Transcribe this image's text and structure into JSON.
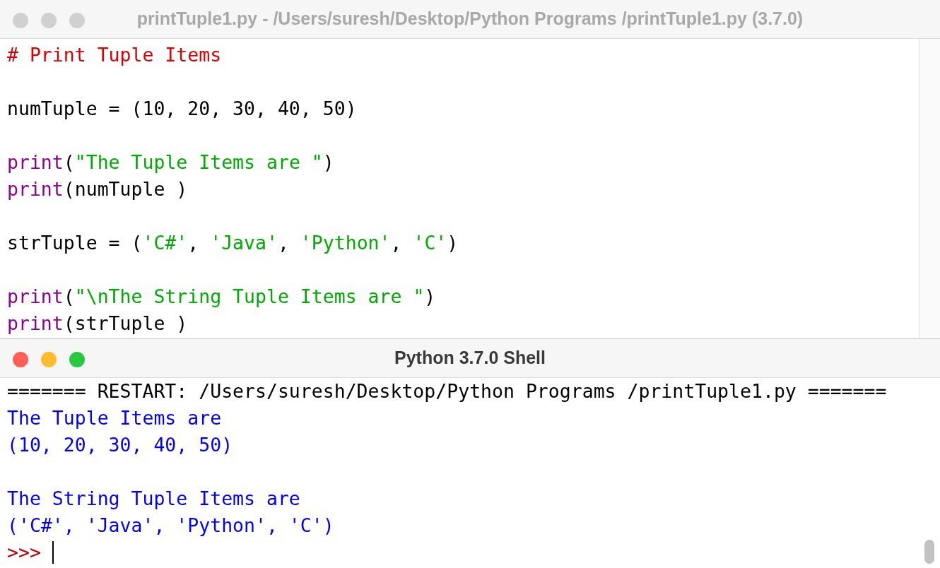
{
  "editor": {
    "title": "printTuple1.py - /Users/suresh/Desktop/Python Programs /printTuple1.py (3.7.0)",
    "active": false,
    "lines": [
      {
        "kind": "code",
        "tokens": [
          {
            "text": "# Print Tuple Items",
            "kind": "comment"
          }
        ]
      },
      {
        "kind": "blank"
      },
      {
        "kind": "code",
        "tokens": [
          {
            "text": "numTuple = (10, 20, 30, 40, 50)",
            "kind": "plain"
          }
        ]
      },
      {
        "kind": "blank"
      },
      {
        "kind": "code",
        "tokens": [
          {
            "text": "print",
            "kind": "builtin"
          },
          {
            "text": "(",
            "kind": "plain"
          },
          {
            "text": "\"The Tuple Items are \"",
            "kind": "string"
          },
          {
            "text": ")",
            "kind": "plain"
          }
        ]
      },
      {
        "kind": "code",
        "tokens": [
          {
            "text": "print",
            "kind": "builtin"
          },
          {
            "text": "(numTuple )",
            "kind": "plain"
          }
        ]
      },
      {
        "kind": "blank"
      },
      {
        "kind": "code",
        "tokens": [
          {
            "text": "strTuple = (",
            "kind": "plain"
          },
          {
            "text": "'C#'",
            "kind": "string"
          },
          {
            "text": ", ",
            "kind": "plain"
          },
          {
            "text": "'Java'",
            "kind": "string"
          },
          {
            "text": ", ",
            "kind": "plain"
          },
          {
            "text": "'Python'",
            "kind": "string"
          },
          {
            "text": ", ",
            "kind": "plain"
          },
          {
            "text": "'C'",
            "kind": "string"
          },
          {
            "text": ")",
            "kind": "plain"
          }
        ]
      },
      {
        "kind": "blank"
      },
      {
        "kind": "code",
        "tokens": [
          {
            "text": "print",
            "kind": "builtin"
          },
          {
            "text": "(",
            "kind": "plain"
          },
          {
            "text": "\"\\nThe String Tuple Items are \"",
            "kind": "string"
          },
          {
            "text": ")",
            "kind": "plain"
          }
        ]
      },
      {
        "kind": "code",
        "tokens": [
          {
            "text": "print",
            "kind": "builtin"
          },
          {
            "text": "(strTuple )",
            "kind": "plain"
          }
        ]
      }
    ]
  },
  "shell": {
    "title": "Python 3.7.0 Shell",
    "active": true,
    "lines": [
      {
        "kind": "restart",
        "text": "======= RESTART: /Users/suresh/Desktop/Python Programs /printTuple1.py ======="
      },
      {
        "kind": "output",
        "text": "The Tuple Items are"
      },
      {
        "kind": "output",
        "text": "(10, 20, 30, 40, 50)"
      },
      {
        "kind": "blank"
      },
      {
        "kind": "output",
        "text": "The String Tuple Items are"
      },
      {
        "kind": "output",
        "text": "('C#', 'Java', 'Python', 'C')"
      },
      {
        "kind": "prompt",
        "text": ">>>"
      }
    ]
  }
}
